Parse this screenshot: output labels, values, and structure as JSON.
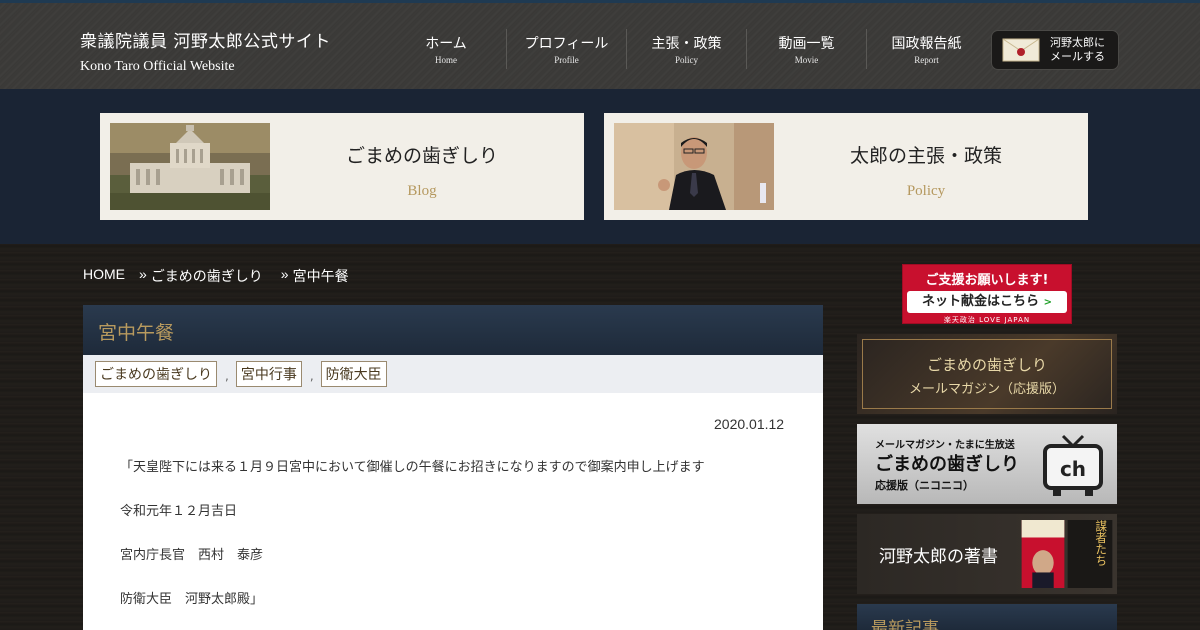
{
  "header": {
    "site_title": "衆議院議員 河野太郎公式サイト",
    "site_subtitle": "Kono Taro Official Website",
    "nav": [
      {
        "jp": "ホーム",
        "en": "Home"
      },
      {
        "jp": "プロフィール",
        "en": "Profile"
      },
      {
        "jp": "主張・政策",
        "en": "Policy"
      },
      {
        "jp": "動画一覧",
        "en": "Movie"
      },
      {
        "jp": "国政報告紙",
        "en": "Report"
      }
    ],
    "mail_button": {
      "line1": "河野太郎に",
      "line2": "メールする",
      "icon": "envelope-icon"
    }
  },
  "banners": [
    {
      "title": "ごまめの歯ぎしり",
      "subtitle": "Blog",
      "image": "diet-building-photo"
    },
    {
      "title": "太郎の主張・政策",
      "subtitle": "Policy",
      "image": "speaker-photo"
    }
  ],
  "breadcrumb": {
    "home": "HOME",
    "sep": "»",
    "level1": "ごまめの歯ぎしり",
    "level2": "宮中午餐"
  },
  "post": {
    "title": "宮中午餐",
    "tags": [
      "ごまめの歯ぎしり",
      "宮中行事",
      "防衛大臣"
    ],
    "tag_separator": ",",
    "date": "2020.01.12",
    "lines": [
      "「天皇陛下には来る１月９日宮中において御催しの午餐にお招きになりますので御案内申し上げます",
      "令和元年１２月吉日",
      "宮内庁長官　西村　泰彦",
      "防衛大臣　河野太郎殿」"
    ]
  },
  "sidebar": {
    "support": {
      "top": "ご支援お願いします!",
      "button": "ネット献金はこちら",
      "arrow": ">",
      "bottom": "楽天政治 LOVE JAPAN"
    },
    "mailmag": {
      "line1": "ごまめの歯ぎしり",
      "line2": "メールマガジン（応援版）"
    },
    "niconico": {
      "line1": "メールマガジン・たまに生放送",
      "line2": "ごまめの歯ぎしり",
      "line3": "応援版（ニコニコ）",
      "logo": "ch"
    },
    "books": {
      "title": "河野太郎の著書",
      "book2": "共謀者たち"
    },
    "recent": {
      "title": "最新記事"
    }
  },
  "colors": {
    "header_bg": "#3c3b39",
    "banner_strip_bg": "#1a2434",
    "card_bg": "#f2efe8",
    "gold": "#b5985e",
    "post_head_bg": "#2a3a4e",
    "support_red": "#c8102e"
  }
}
